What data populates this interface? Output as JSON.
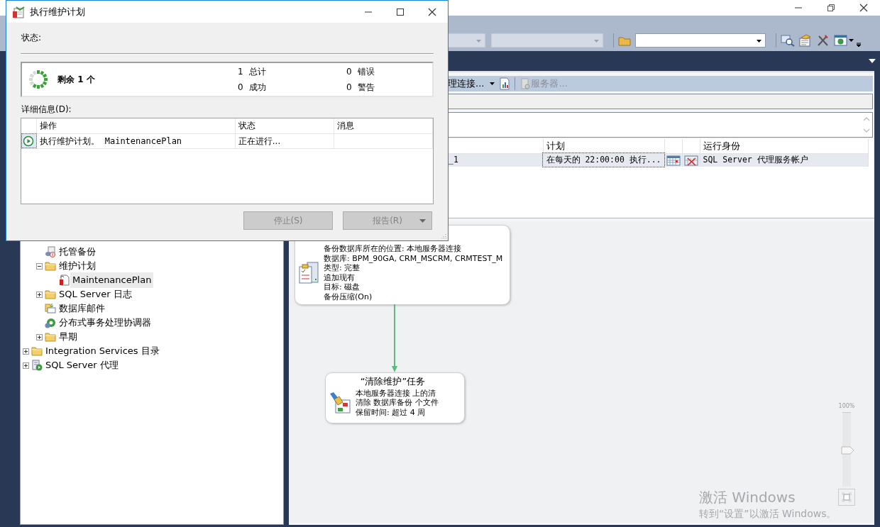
{
  "toolbar": {
    "combos": [
      {
        "disabled": true
      },
      {
        "disabled": true
      },
      {
        "disabled": false
      }
    ]
  },
  "dialog": {
    "title": "执行维护计划",
    "status_label": "状态:",
    "remaining": "剩余 1 个",
    "stats": [
      {
        "text": "1 总计"
      },
      {
        "text": "0 错误"
      },
      {
        "text": "0 成功"
      },
      {
        "text": "0 警告"
      }
    ],
    "details_label": "详细信息(D):",
    "columns": [
      "操作",
      "状态",
      "消息"
    ],
    "rows": [
      {
        "action": "执行维护计划。 MaintenancePlan",
        "status": "正在进行..."
      }
    ],
    "buttons": [
      {
        "label": "停止(S)",
        "disabled": true,
        "dropdown": false
      },
      {
        "label": "报告(R)",
        "disabled": true,
        "dropdown": true
      }
    ]
  },
  "object_explorer": {
    "tree": [
      {
        "children": [
          {
            "label": "托管备份",
            "kind": "backup",
            "selected": false
          },
          {
            "label": "维护计划",
            "kind": "folder",
            "expanded": true,
            "selected": false,
            "children": [
              {
                "label": "MaintenancePlan",
                "kind": "plan",
                "selected": true
              }
            ]
          },
          {
            "label": "SQL Server 日志",
            "kind": "folder",
            "expanded": false,
            "selected": false
          },
          {
            "label": "数据库邮件",
            "kind": "mail",
            "selected": false
          },
          {
            "label": "分布式事务处理协调器",
            "kind": "dtc",
            "selected": false
          },
          {
            "label": "早期",
            "kind": "folder",
            "expanded": false,
            "selected": false
          }
        ]
      },
      {
        "label": "Integration Services 目录",
        "kind": "folder",
        "expanded": false,
        "selected": false
      },
      {
        "label": "SQL Server 代理",
        "kind": "agent",
        "expanded": false,
        "selected": false
      }
    ]
  },
  "job_panel": {
    "toolbar": [
      {
        "label": "理连接...",
        "dropdown": true,
        "disabled": false
      },
      {
        "label": "服务器...",
        "dropdown": false,
        "disabled": true
      }
    ],
    "columns": [
      {
        "kind": "text"
      },
      {
        "kind": "text",
        "label": "计划"
      },
      {
        "kind": "icon"
      },
      {
        "kind": "icon"
      },
      {
        "kind": "text",
        "label": "运行身份"
      }
    ],
    "rows": [
      {
        "name": "_1",
        "schedule": "在每天的 22:00:00 执行...",
        "run_as": "SQL Server 代理服务帐户"
      }
    ]
  },
  "designer": {
    "tasks": [
      {
        "kind": "backup",
        "lines": [
          "备份数据库所在的位置: 本地服务器连接",
          "数据库: BPM_90GA, CRM_MSCRM, CRMTEST_M",
          "类型: 完整",
          "追加现有",
          "目标: 磁盘",
          "备份压缩(On)"
        ]
      },
      {
        "kind": "cleanup",
        "title": "“清除维护”任务",
        "lines": [
          "本地服务器连接 上的清",
          "清除 数据库备份 个文件",
          "保留时间: 超过 4 周"
        ]
      }
    ],
    "zoom": {
      "label": "100%",
      "level": 0.5
    },
    "activation_notice": {
      "title": "激活 Windows",
      "text": "转到“设置”以激活 Windows。"
    }
  }
}
